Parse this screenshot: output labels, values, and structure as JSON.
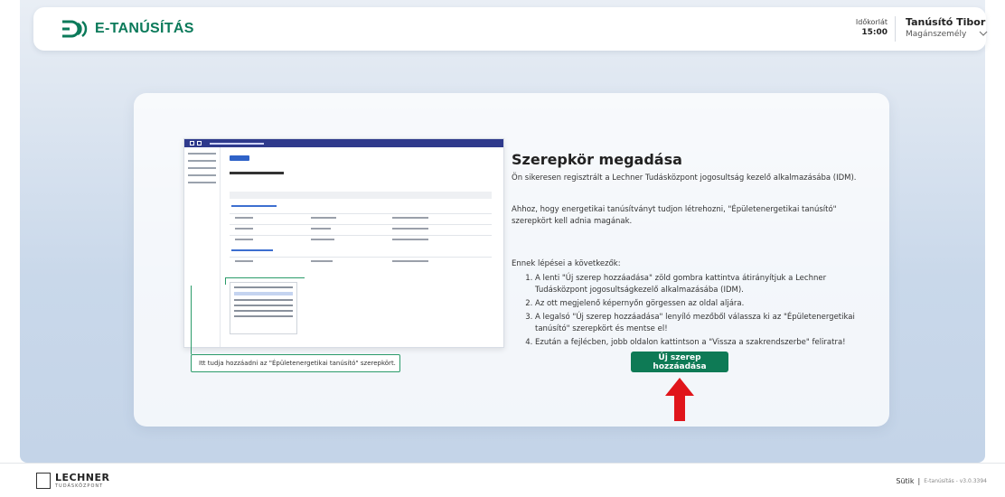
{
  "header": {
    "logo_text": "E-TANÚSÍTÁS",
    "timer_label": "Időkorlát",
    "timer_value": "15:00",
    "user_name": "Tanúsító Tibor",
    "user_role": "Magánszemély"
  },
  "content": {
    "title": "Szerepkör megadása",
    "para1": "Ön sikeresen regisztrált a Lechner Tudásközpont jogosultság kezelő alkalmazásába (IDM).",
    "para2": "Ahhoz, hogy energetikai tanúsítványt tudjon létrehozni, \"Épületenergetikai tanúsító\" szerepkört kell adnia magának.",
    "steps_intro": "Ennek lépései a következők:",
    "steps": [
      "A lenti \"Új szerep hozzáadása\" zöld gombra kattintva átirányítjuk a Lechner Tudásközpont jogosultságkezelő alkalmazásába (IDM).",
      "Az ott megjelenő képernyőn görgessen az oldal aljára.",
      "A legalsó \"Új szerep hozzáadása\" lenyíló mezőből válassza ki az \"Épületenergetikai tanúsító\" szerepkört és mentse el!",
      "Ezután a fejlécben, jobb oldalon kattintson a \"Vissza a szakrendszerbe\" feliratra!"
    ],
    "callout": "Itt tudja hozzáadni az \"Épületenergetikai tanúsító\" szerepkört.",
    "add_button": "Új szerep hozzáadása"
  },
  "footer": {
    "logo_big": "LECHNER",
    "logo_small": "TUDÁSKÖZPONT",
    "cookies": "Sütik",
    "separator": "|",
    "version": "E-tanúsítás - v3.0.3394"
  },
  "colors": {
    "accent": "#0e7a55",
    "arrow": "#e0151b"
  }
}
